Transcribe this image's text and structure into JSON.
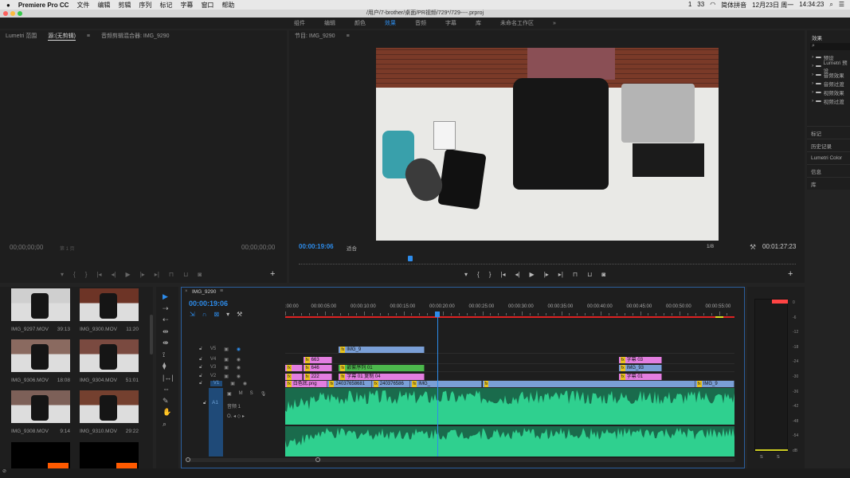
{
  "menubar": {
    "apple": "",
    "app": "Premiere Pro CC",
    "items": [
      "文件",
      "编辑",
      "剪辑",
      "序列",
      "标记",
      "字幕",
      "窗口",
      "帮助"
    ],
    "status": [
      "1",
      "33",
      "简体拼音",
      "12月23日 周一",
      "14:34:23"
    ]
  },
  "window": {
    "title": "/用户/7-brother/桌面/PR视频/729*/729----.prproj"
  },
  "workspaces": {
    "items": [
      "组件",
      "编辑",
      "颜色",
      "效果",
      "音频",
      "字幕",
      "库",
      "未命名工作区"
    ],
    "active": 3,
    "more": "»"
  },
  "source": {
    "tabs": [
      "Lumetri 范围",
      "源:(无剪辑)",
      "音频剪辑混合器: IMG_9290"
    ],
    "timecode_left": "00;00;00;00",
    "timecode_right": "00;00;00;00",
    "page": "第 1 页"
  },
  "program": {
    "tab": "节目: IMG_9290",
    "timecode": "00:00:19:06",
    "fit": "适合",
    "resolution": "1/8",
    "duration": "00:01:27:23",
    "playhead_fraction": 0.22
  },
  "effects": {
    "title": "效果",
    "items": [
      "预设",
      "Lumetri 预设",
      "音频效果",
      "音频过渡",
      "视频效果",
      "视频过渡"
    ],
    "sections": [
      "标记",
      "历史记录",
      "Lumetri Color",
      "信息",
      "库"
    ]
  },
  "project": {
    "items": [
      {
        "name": "IMG_9297.MOV",
        "dur": "39:13"
      },
      {
        "name": "IMG_9300.MOV",
        "dur": "11:20"
      },
      {
        "name": "IMG_9306.MOV",
        "dur": "18:08"
      },
      {
        "name": "IMG_9304.MOV",
        "dur": "51:01"
      },
      {
        "name": "IMG_9308.MOV",
        "dur": "9:14"
      },
      {
        "name": "IMG_9310.MOV",
        "dur": "29:22"
      }
    ]
  },
  "timeline": {
    "tab": "IMG_9290",
    "timecode": "00:00:19:06",
    "playhead_s": 19.25,
    "ruler": [
      ":00:00",
      "00:00:05:00",
      "00:00:10:00",
      "00:00:15:00",
      "00:00:20:00",
      "00:00:25:00",
      "00:00:30:00",
      "00:00:35:00",
      "00:00:40:00",
      "00:00:45:00",
      "00:00:50:00",
      "00:00:55:00"
    ],
    "tracks": [
      "V5",
      "V4",
      "V3",
      "V2",
      "V1"
    ],
    "audio_track": "A1",
    "audio_name": "音频 1",
    "audio_buttons": [
      "M",
      "S"
    ],
    "clips": [
      {
        "track": "V5",
        "start": 6.8,
        "end": 17.7,
        "color": "#7a9fd6",
        "label": "IMG_9"
      },
      {
        "track": "V4",
        "start": 2.3,
        "end": 6,
        "color": "#e37ee0",
        "label": "663"
      },
      {
        "track": "V4",
        "start": 42.3,
        "end": 47.8,
        "color": "#e37ee0",
        "label": "字幕 03"
      },
      {
        "track": "V3",
        "start": 0,
        "end": 2.2,
        "color": "#e37ee0",
        "label": ""
      },
      {
        "track": "V3",
        "start": 2.3,
        "end": 6,
        "color": "#e37ee0",
        "label": "646"
      },
      {
        "track": "V3",
        "start": 6.8,
        "end": 17.7,
        "color": "#4cb84c",
        "label": "嵌套序列 01"
      },
      {
        "track": "V3",
        "start": 42.3,
        "end": 47.8,
        "color": "#7a9fd6",
        "label": "IMG_93"
      },
      {
        "track": "V2",
        "start": 0,
        "end": 2.2,
        "color": "#e37ee0",
        "label": ""
      },
      {
        "track": "V2",
        "start": 2.3,
        "end": 6,
        "color": "#e37ee0",
        "label": "222"
      },
      {
        "track": "V2",
        "start": 6.8,
        "end": 17.7,
        "color": "#e37ee0",
        "label": "字幕 01 复制 04"
      },
      {
        "track": "V2",
        "start": 42.3,
        "end": 47.8,
        "color": "#e37ee0",
        "label": "字幕 01"
      },
      {
        "track": "V1",
        "start": 0,
        "end": 5.4,
        "color": "#e37ee0",
        "label": "白色底.png"
      },
      {
        "track": "V1",
        "start": 5.4,
        "end": 11,
        "color": "#7a9fd6",
        "label": "24037658681"
      },
      {
        "track": "V1",
        "start": 11,
        "end": 15.9,
        "color": "#7a9fd6",
        "label": "240376586"
      },
      {
        "track": "V1",
        "start": 15.9,
        "end": 25,
        "color": "#7a9fd6",
        "label": "IMG_"
      },
      {
        "track": "V1",
        "start": 25,
        "end": 52,
        "color": "#7a9fd6",
        "label": ""
      },
      {
        "track": "V1",
        "start": 52,
        "end": 57,
        "color": "#7a9fd6",
        "label": "IMG_9"
      }
    ]
  },
  "meters": {
    "scale": [
      "0",
      "-6",
      "-12",
      "-18",
      "-24",
      "-30",
      "-36",
      "-42",
      "-48",
      "-54",
      "dB"
    ],
    "solo": [
      "S",
      "S"
    ]
  },
  "colors": {
    "accent": "#2d8ceb",
    "audio": "#2fd08f",
    "audio_dark": "#1a6b4c",
    "render_bar": "#d22",
    "peak": "#f44"
  }
}
